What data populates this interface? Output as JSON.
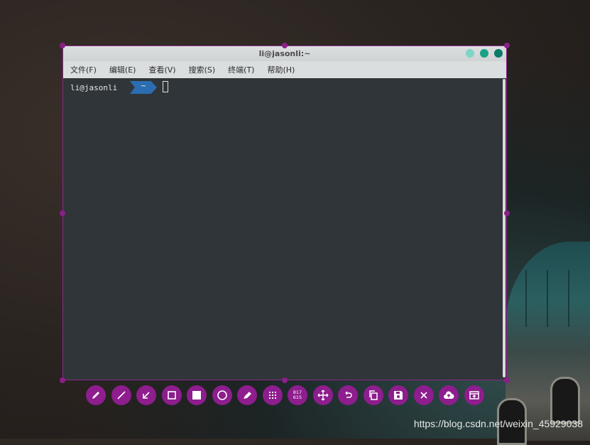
{
  "window": {
    "title": "li@jasonli:~",
    "button_colors": [
      "#7fd4c8",
      "#1aa385",
      "#0b7a66"
    ]
  },
  "menu": [
    "文件(F)",
    "编辑(E)",
    "查看(V)",
    "搜索(S)",
    "终端(T)",
    "帮助(H)"
  ],
  "terminal": {
    "prompt_user": "li@jasonli",
    "prompt_dir": "~"
  },
  "toolbar": {
    "selection_size_top": "817",
    "selection_size_bottom": "615",
    "tools": [
      "pencil-icon",
      "line-icon",
      "arrow-icon",
      "rectangle-outline-icon",
      "rectangle-filled-icon",
      "circle-icon",
      "marker-icon",
      "pixelate-icon",
      "selection-size-counter",
      "move-icon",
      "undo-icon",
      "copy-icon",
      "save-icon",
      "close-icon",
      "upload-icon",
      "pin-icon"
    ]
  },
  "watermark": "https://blog.csdn.net/weixin_45929038",
  "colors": {
    "accent": "#8e1d8e",
    "terminal_bg": "#2f3538",
    "prompt_badge": "#2b6db0"
  }
}
